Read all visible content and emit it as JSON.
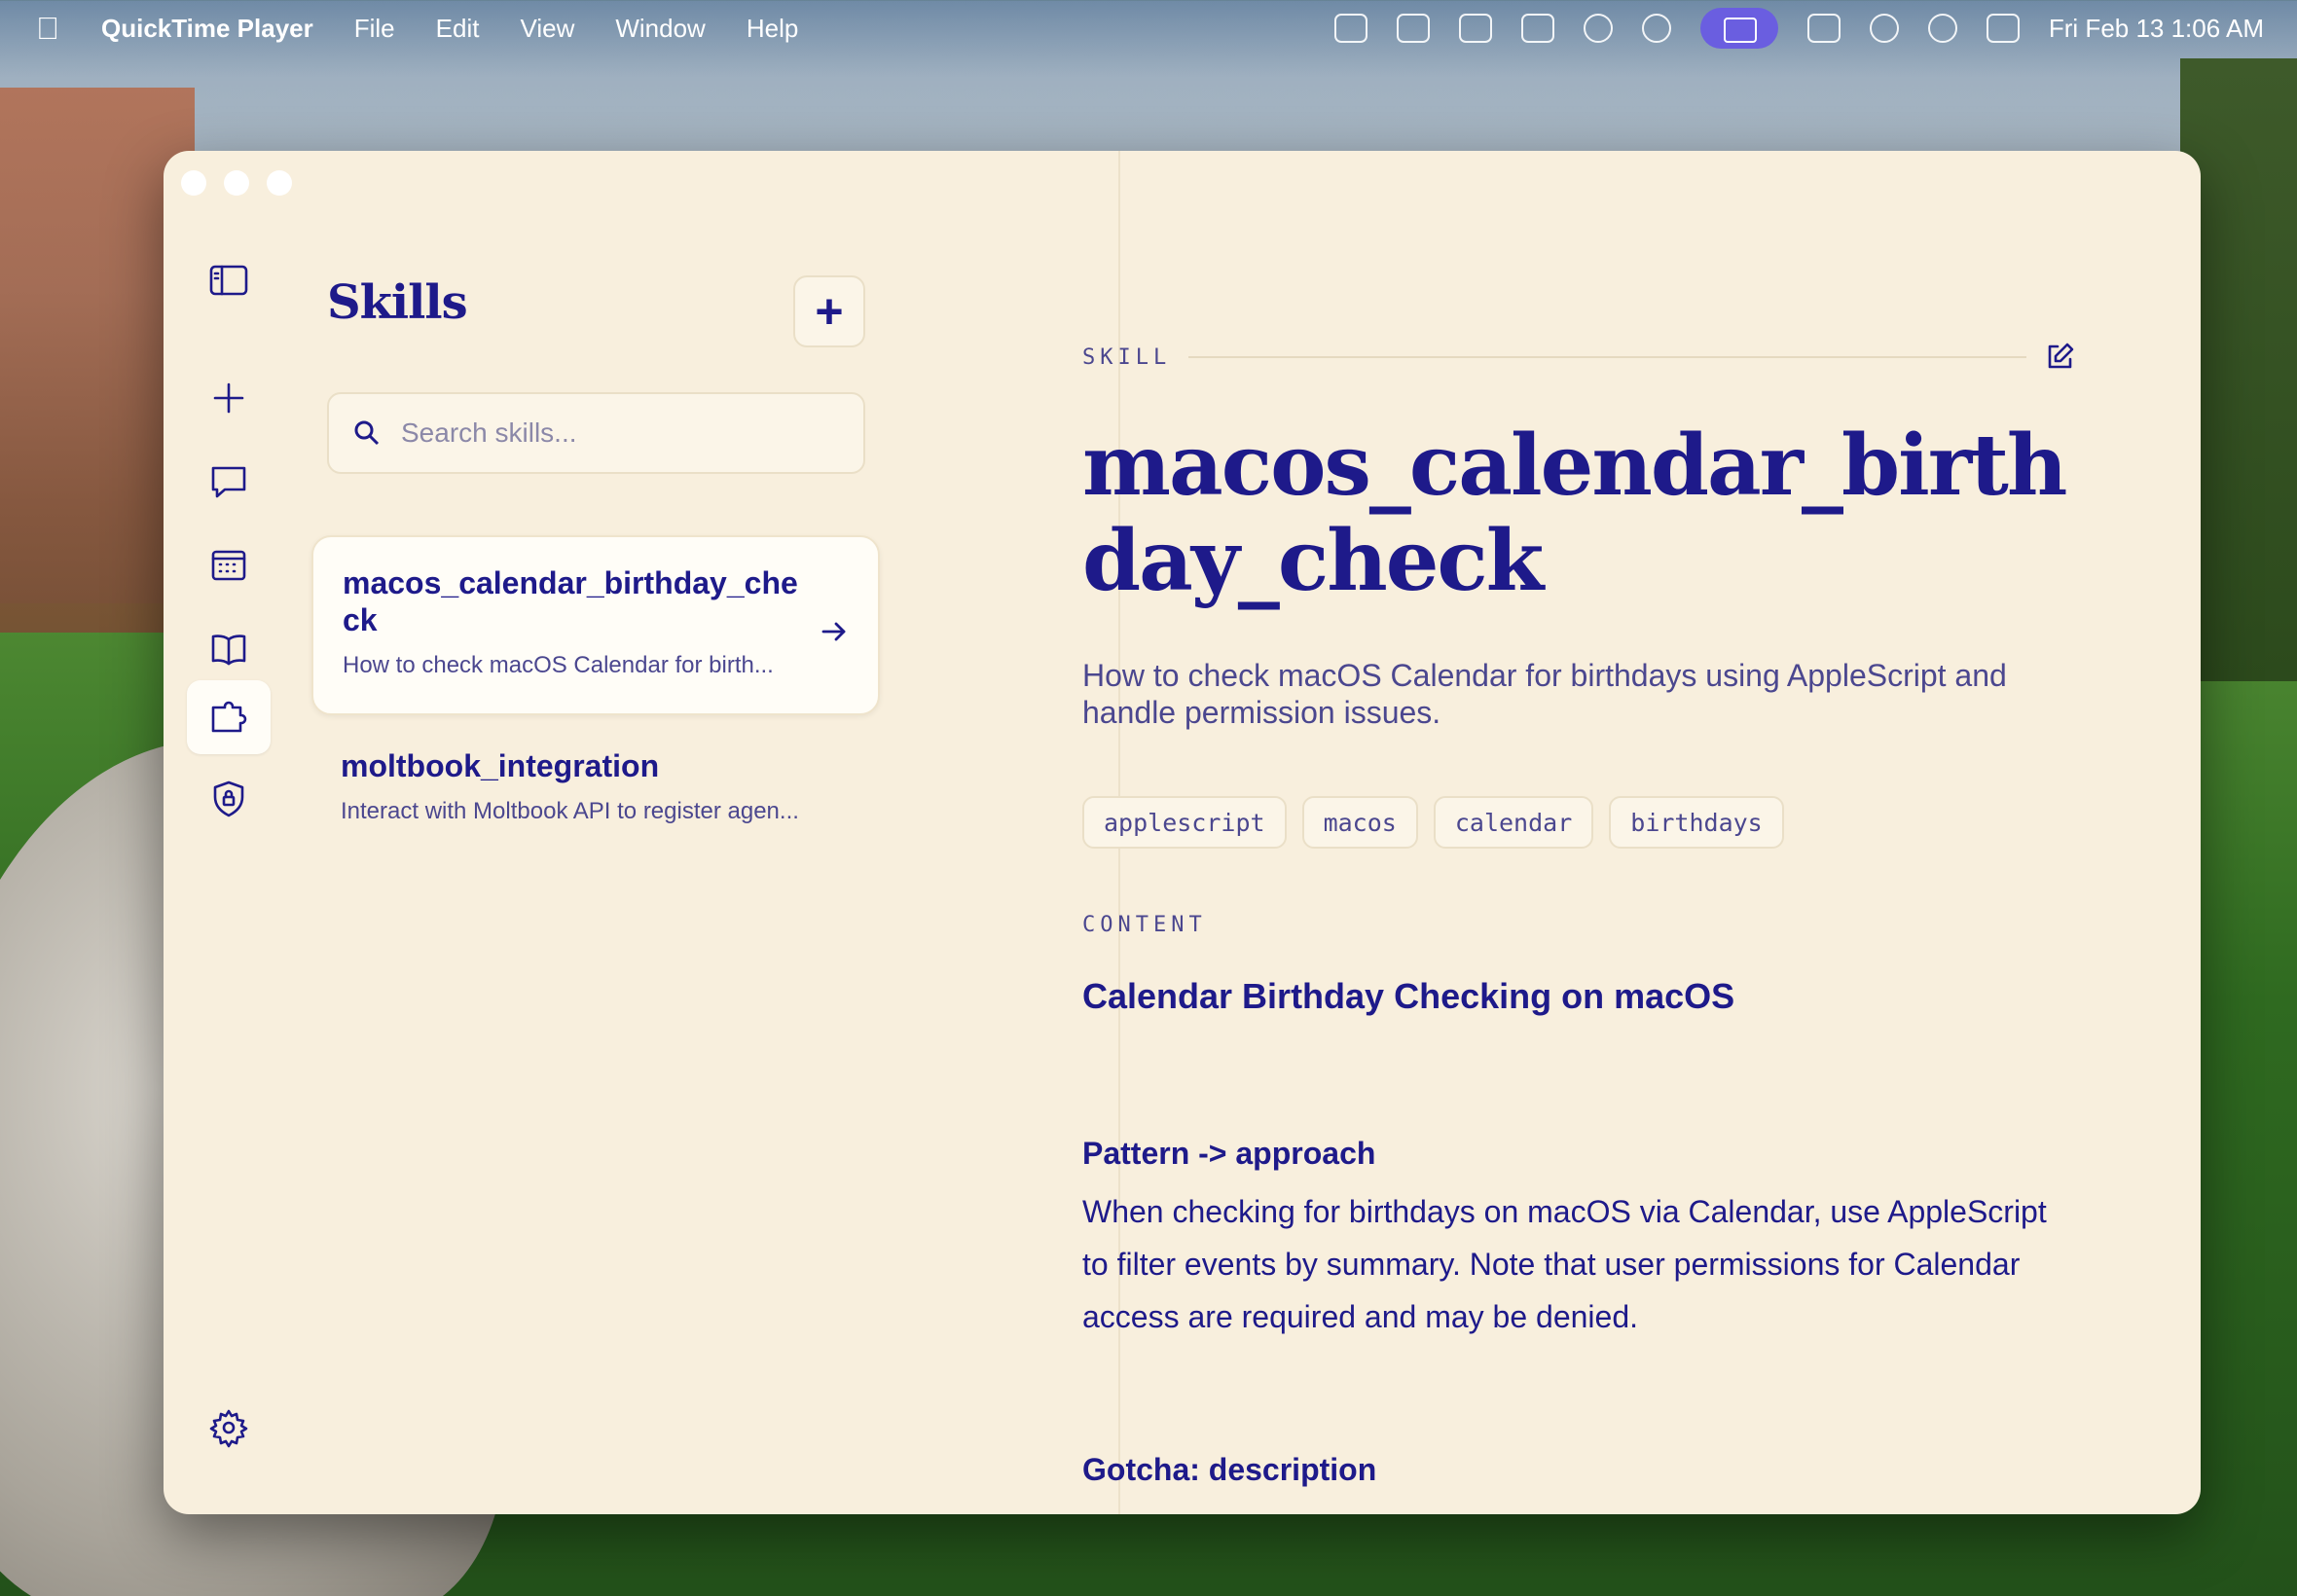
{
  "menubar": {
    "app_name": "QuickTime Player",
    "menus": [
      "File",
      "Edit",
      "View",
      "Window",
      "Help"
    ],
    "clock": "Fri Feb 13  1:06 AM"
  },
  "list": {
    "title": "Skills",
    "add_label": "+",
    "search_placeholder": "Search skills...",
    "items": [
      {
        "name": "macos_calendar_birthday_check",
        "desc": "How to check macOS Calendar for birth..."
      },
      {
        "name": "moltbook_integration",
        "desc": "Interact with Moltbook API to register agen..."
      }
    ]
  },
  "detail": {
    "section_label": "SKILL",
    "title": "macos_calendar_birthday_check",
    "description": "How to check macOS Calendar for birthdays using AppleScript and handle permission issues.",
    "tags": [
      "applescript",
      "macos",
      "calendar",
      "birthdays"
    ],
    "content_label": "CONTENT",
    "content_heading": "Calendar Birthday Checking on macOS",
    "pattern_heading": "Pattern -> approach",
    "pattern_text": "When checking for birthdays on macOS via Calendar, use AppleScript to filter events by summary. Note that user permissions for Calendar access are required and may be denied.",
    "gotcha_heading": "Gotcha: description"
  },
  "colors": {
    "window_bg": "#f8efdd",
    "accent": "#1e1a8a",
    "muted": "#4b478f"
  }
}
